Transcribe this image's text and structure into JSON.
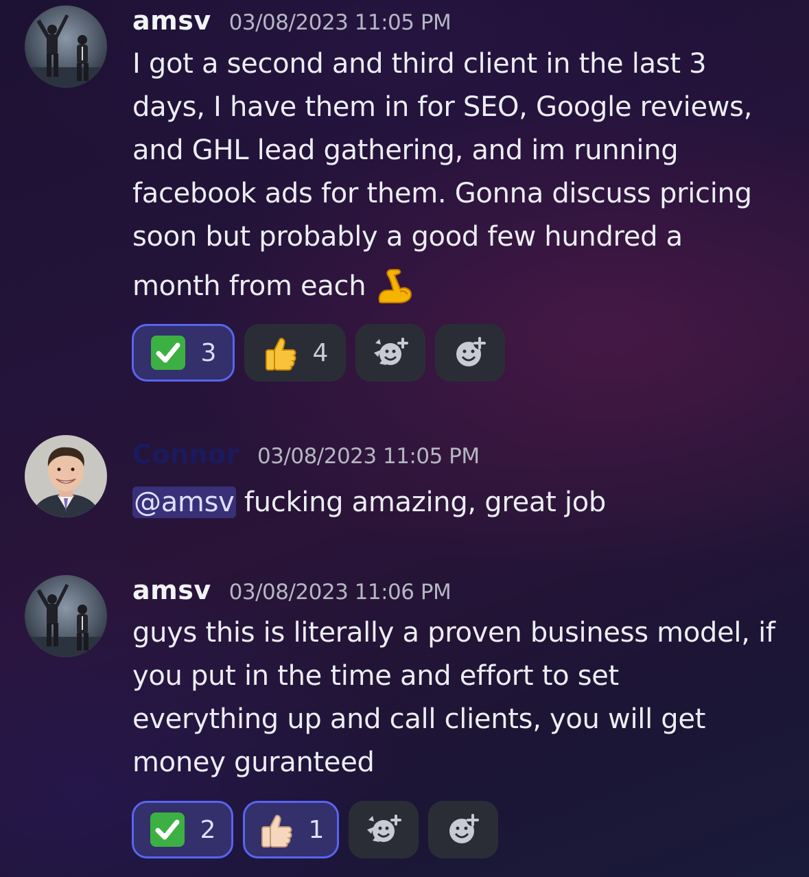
{
  "messages": [
    {
      "username": "amsv",
      "timestamp": "03/08/2023 11:05 PM",
      "text_lines": [
        "I got a second and third client in the last 3",
        "days, I have them in for SEO, Google reviews,",
        "and GHL lead gathering, and im running",
        "facebook ads for them. Gonna discuss pricing",
        "soon but probably a good few hundred a",
        "month from each"
      ],
      "trailing_emoji": "flexed-biceps",
      "reactions": [
        {
          "emoji": "white-check-mark",
          "count": "3",
          "active": true
        },
        {
          "emoji": "thumbs-up",
          "count": "4",
          "active": false
        }
      ]
    },
    {
      "username": "Connor",
      "timestamp": "03/08/2023 11:05 PM",
      "mention": "@amsv",
      "text": " fucking amazing, great job"
    },
    {
      "username": "amsv",
      "timestamp": "03/08/2023 11:06 PM",
      "text_lines": [
        "guys this is literally a proven business model, if",
        "you put in the time and effort to set",
        "everything up and call clients, you will get",
        "money guranteed"
      ],
      "reactions": [
        {
          "emoji": "white-check-mark",
          "count": "2",
          "active": true
        },
        {
          "emoji": "thumbs-up-light-skin",
          "count": "1",
          "active": true
        }
      ]
    }
  ],
  "colors": {
    "mention_bg": "#5865f2",
    "active_reaction_border": "#5865f2",
    "connor_name": "#1a1a5e"
  },
  "icons": {
    "add_reaction": "add-reaction-icon",
    "super_reaction": "add-super-reaction-icon"
  }
}
